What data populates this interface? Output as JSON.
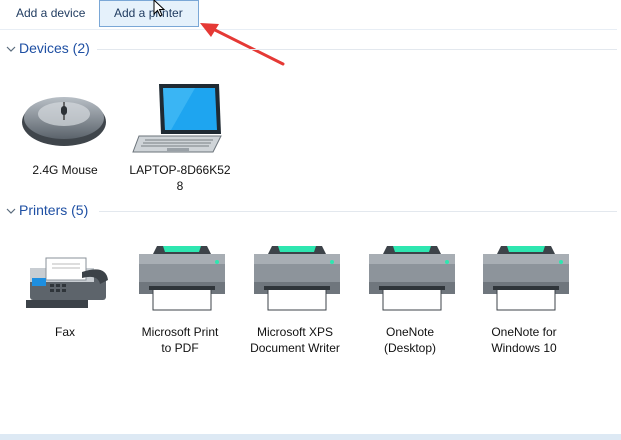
{
  "toolbar": {
    "add_device": "Add a device",
    "add_printer": "Add a printer"
  },
  "sections": {
    "devices": {
      "title": "Devices (2)"
    },
    "printers": {
      "title": "Printers (5)"
    }
  },
  "devices": [
    {
      "label": "2.4G Mouse",
      "icon": "mouse-icon"
    },
    {
      "label": "LAPTOP-8D66K52\n8",
      "icon": "laptop-icon"
    }
  ],
  "printers": [
    {
      "label": "Fax",
      "icon": "fax-icon"
    },
    {
      "label": "Microsoft Print\nto PDF",
      "icon": "printer-icon"
    },
    {
      "label": "Microsoft XPS\nDocument Writer",
      "icon": "printer-icon"
    },
    {
      "label": "OneNote\n(Desktop)",
      "icon": "printer-icon"
    },
    {
      "label": "OneNote for\nWindows 10",
      "icon": "printer-icon"
    }
  ],
  "colors": {
    "section_title": "#1e4fa3",
    "selected_button_bg": "#e5f1fb",
    "annotation_arrow": "#e53935"
  }
}
